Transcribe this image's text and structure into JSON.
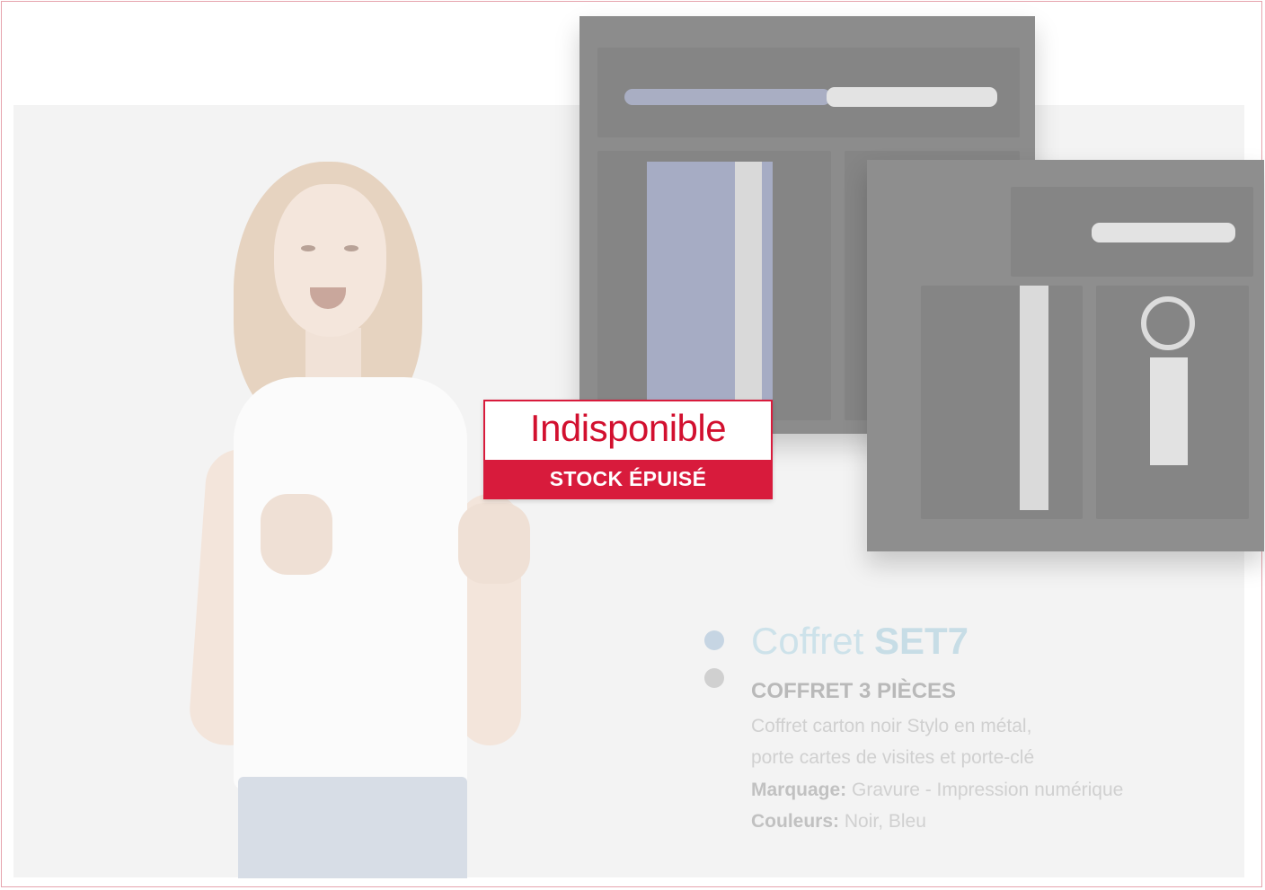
{
  "badge": {
    "title": "Indisponible",
    "subtitle": "STOCK ÉPUISÉ",
    "color": "#d81b3c"
  },
  "product": {
    "title_prefix": "Coffret",
    "title_code": "SET7",
    "subtitle": "COFFRET 3 PIÈCES",
    "description_line1": "Coffret carton noir Stylo en métal,",
    "description_line2": "porte cartes de visites et porte-clé",
    "marking_label": "Marquage:",
    "marking_value": "Gravure - Impression numérique",
    "colors_label": "Couleurs:",
    "colors_value": "Noir, Bleu"
  }
}
